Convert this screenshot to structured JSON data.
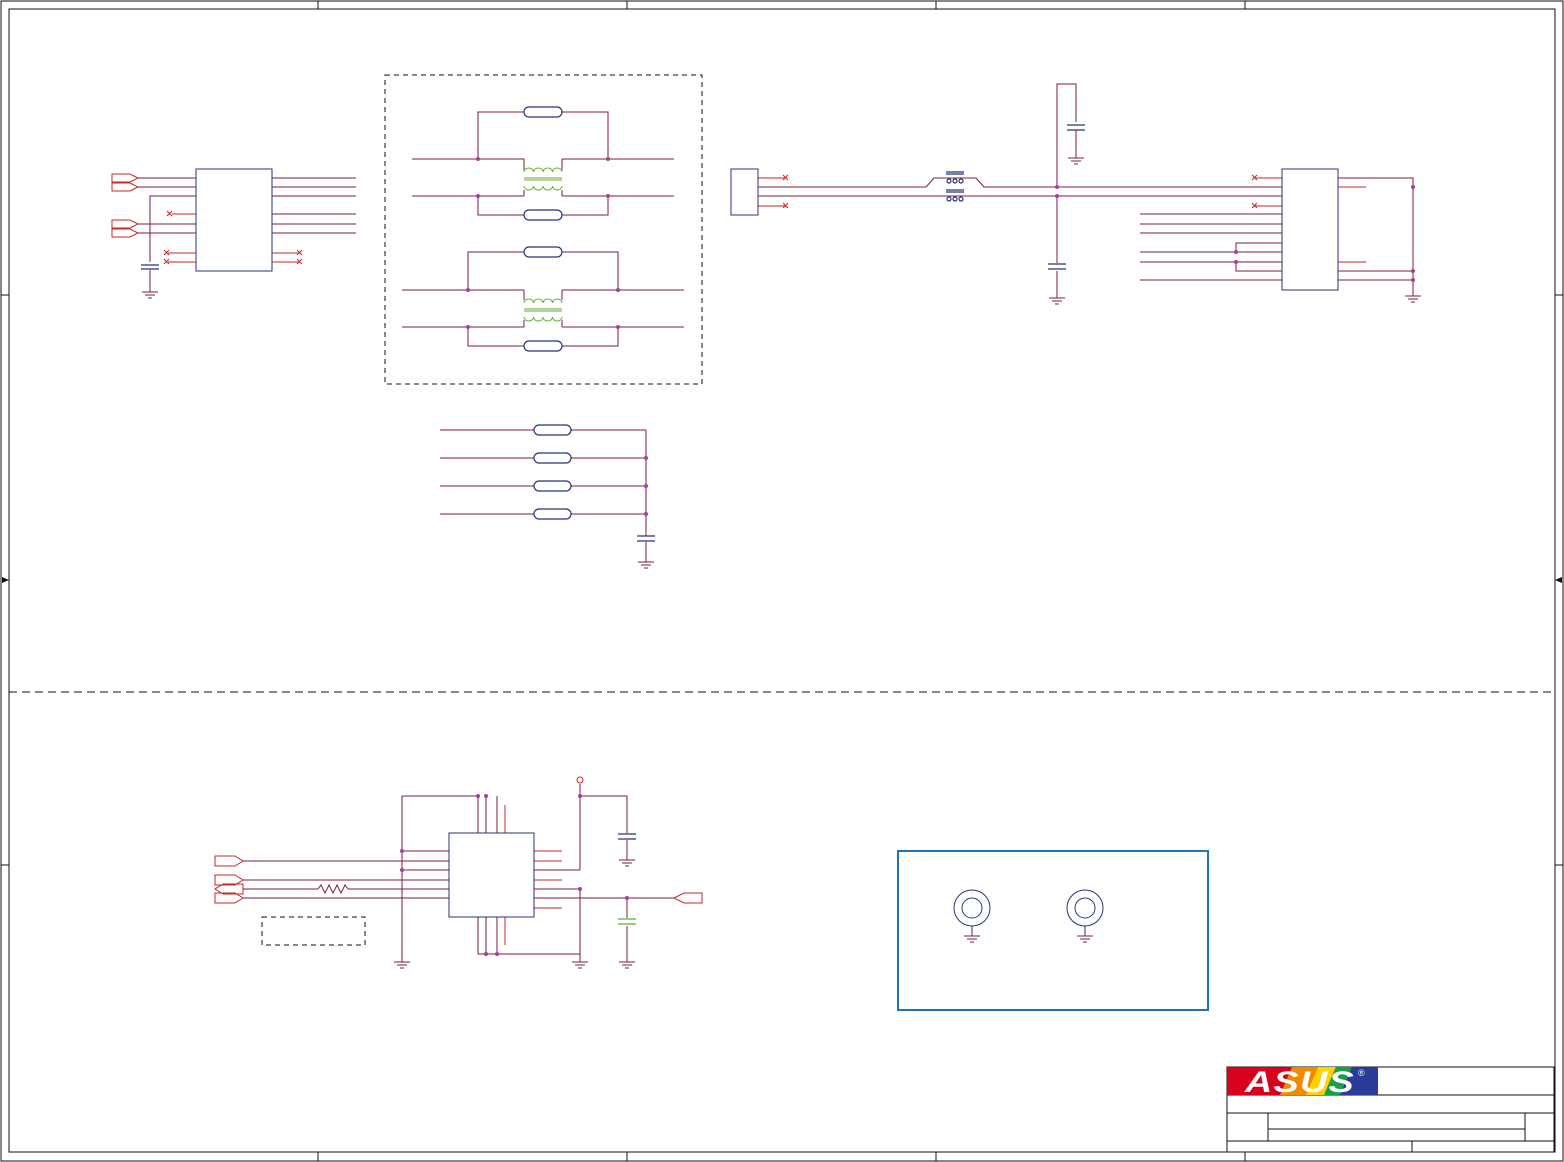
{
  "title_block": {
    "brand_text": "ASUS",
    "reg_mark": "®",
    "brand_colors": [
      "#d7001d",
      "#f08a00",
      "#ffd200",
      "#16a04a",
      "#2b3b9a"
    ],
    "logo_background": "#d7001d"
  },
  "colors": {
    "border": "#111111",
    "wire": "#7b1d3f",
    "net_port": "#c62828",
    "component_blue": "#26357a",
    "transformer_green": "#66aa33",
    "junction": "#a23ea0",
    "mounting_frame": "#1f73b7"
  },
  "sections": {
    "top": [
      "bridge-ic",
      "common-mode-choke-block",
      "usb-connector-chain",
      "ferrite-termination"
    ],
    "bottom": [
      "regulator-ic",
      "mounting-holes"
    ]
  },
  "mounting_holes": {
    "count": 2
  }
}
